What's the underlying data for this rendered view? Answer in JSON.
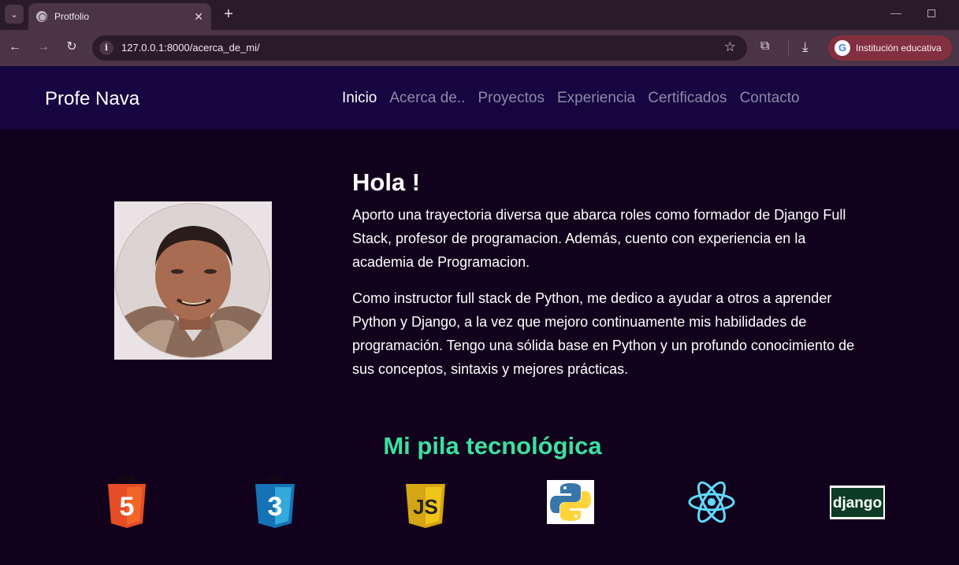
{
  "browser": {
    "tab_title": "Protfolio",
    "url": "127.0.0.1:8000/acerca_de_mi/",
    "profile_label": "Institución educativa"
  },
  "site": {
    "brand": "Profe Nava",
    "menu": [
      {
        "label": "Inicio",
        "active": true
      },
      {
        "label": "Acerca de..",
        "active": false
      },
      {
        "label": "Proyectos",
        "active": false
      },
      {
        "label": "Experiencia",
        "active": false
      },
      {
        "label": "Certificados",
        "active": false
      },
      {
        "label": "Contacto",
        "active": false
      }
    ]
  },
  "about": {
    "heading": "Hola !",
    "paragraph1": "Aporto una trayectoria diversa que abarca roles como formador de Django Full Stack, profesor de programacion. Además, cuento con experiencia en la academia de Programacion.",
    "paragraph2": "Como instructor full stack de Python, me dedico a ayudar a otros a aprender Python y Django, a la vez que mejoro continuamente mis habilidades de programación. Tengo una sólida base en Python y un profundo conocimiento de sus conceptos, sintaxis y mejores prácticas."
  },
  "stack": {
    "title": "Mi pila tecnológica",
    "items": [
      {
        "name": "html5-icon",
        "label": "HTML",
        "glyph": "5"
      },
      {
        "name": "css3-icon",
        "label": "CSS",
        "glyph": "3"
      },
      {
        "name": "javascript-icon",
        "label": "JS",
        "glyph": "JS"
      },
      {
        "name": "python-icon"
      },
      {
        "name": "react-icon"
      },
      {
        "name": "django-icon",
        "label": "django"
      }
    ]
  },
  "colors": {
    "nav_bg": "#160540",
    "page_bg": "#12011c",
    "accent": "#3be0a0"
  }
}
